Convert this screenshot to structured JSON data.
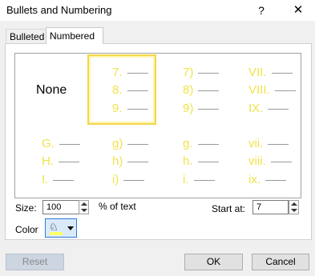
{
  "window": {
    "title": "Bullets and Numbering",
    "help": "?",
    "close": "✕"
  },
  "tabs": [
    {
      "label": "Bulleted",
      "active": false
    },
    {
      "label": "Numbered",
      "active": true
    }
  ],
  "gallery": {
    "none_label": "None",
    "styles": [
      {
        "lines": [
          "7.",
          "8.",
          "9."
        ],
        "selected": true
      },
      {
        "lines": [
          "7)",
          "8)",
          "9)"
        ],
        "selected": false
      },
      {
        "lines": [
          "VII.",
          "VIII.",
          "IX."
        ],
        "selected": false
      },
      {
        "lines": [
          "G.",
          "H.",
          "I."
        ],
        "selected": false
      },
      {
        "lines": [
          "g)",
          "h)",
          "i)"
        ],
        "selected": false
      },
      {
        "lines": [
          "g.",
          "h.",
          "i."
        ],
        "selected": false
      },
      {
        "lines": [
          "vii.",
          "viii.",
          "ix."
        ],
        "selected": false
      }
    ],
    "number_color": "#f0e34a"
  },
  "size": {
    "label": "Size:",
    "value": "100",
    "suffix": "% of text"
  },
  "start_at": {
    "label": "Start at:",
    "value": "7"
  },
  "color": {
    "label": "Color",
    "swatch": "#ffff66",
    "icon": "paint-bucket-icon"
  },
  "buttons": {
    "reset": "Reset",
    "ok": "OK",
    "cancel": "Cancel"
  }
}
